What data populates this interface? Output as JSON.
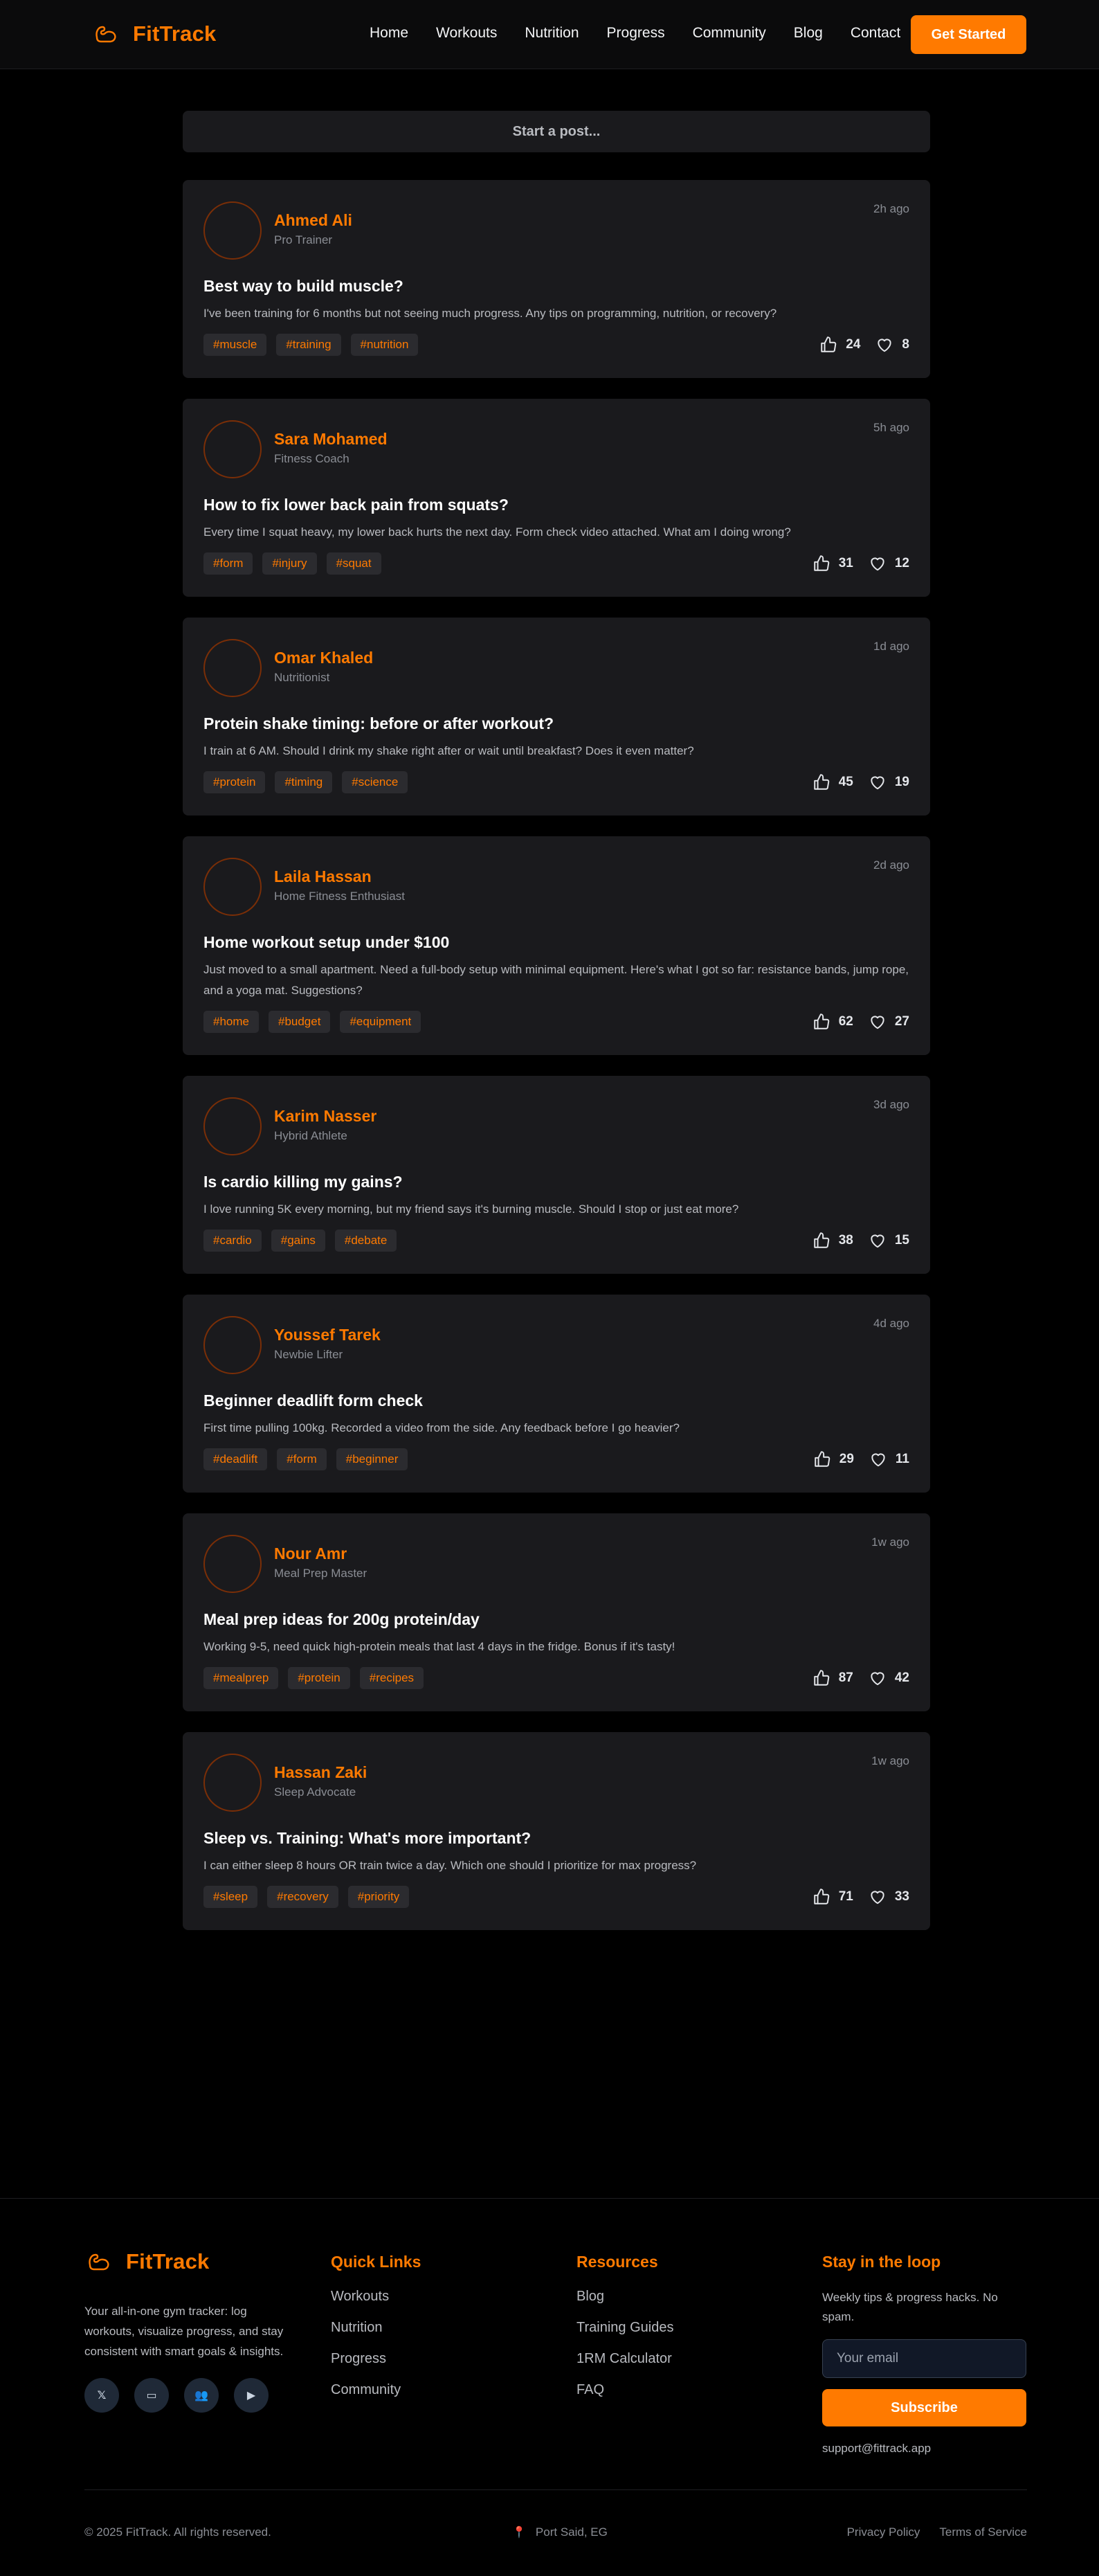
{
  "brand": {
    "name": "FitTrack",
    "accent": "#ff7a00",
    "icon": "flexed-arm-icon"
  },
  "nav": {
    "items": [
      "Home",
      "Workouts",
      "Nutrition",
      "Progress",
      "Community",
      "Blog",
      "Contact"
    ],
    "cta": "Get Started"
  },
  "composer": {
    "label": "Start a post..."
  },
  "posts": [
    {
      "author": "Ahmed Ali",
      "role": "Pro Trainer",
      "time": "2h ago",
      "title": "Best way to build muscle?",
      "body": "I've been training for 6 months but not seeing much progress. Any tips on programming, nutrition, or recovery?",
      "tags": [
        "#muscle",
        "#training",
        "#nutrition"
      ],
      "likes": "24",
      "hearts": "8"
    },
    {
      "author": "Sara Mohamed",
      "role": "Fitness Coach",
      "time": "5h ago",
      "title": "How to fix lower back pain from squats?",
      "body": "Every time I squat heavy, my lower back hurts the next day. Form check video attached. What am I doing wrong?",
      "tags": [
        "#form",
        "#injury",
        "#squat"
      ],
      "likes": "31",
      "hearts": "12"
    },
    {
      "author": "Omar Khaled",
      "role": "Nutritionist",
      "time": "1d ago",
      "title": "Protein shake timing: before or after workout?",
      "body": "I train at 6 AM. Should I drink my shake right after or wait until breakfast? Does it even matter?",
      "tags": [
        "#protein",
        "#timing",
        "#science"
      ],
      "likes": "45",
      "hearts": "19"
    },
    {
      "author": "Laila Hassan",
      "role": "Home Fitness Enthusiast",
      "time": "2d ago",
      "title": "Home workout setup under $100",
      "body": "Just moved to a small apartment. Need a full-body setup with minimal equipment. Here's what I got so far: resistance bands, jump rope, and a yoga mat. Suggestions?",
      "tags": [
        "#home",
        "#budget",
        "#equipment"
      ],
      "likes": "62",
      "hearts": "27"
    },
    {
      "author": "Karim Nasser",
      "role": "Hybrid Athlete",
      "time": "3d ago",
      "title": "Is cardio killing my gains?",
      "body": "I love running 5K every morning, but my friend says it's burning muscle. Should I stop or just eat more?",
      "tags": [
        "#cardio",
        "#gains",
        "#debate"
      ],
      "likes": "38",
      "hearts": "15"
    },
    {
      "author": "Youssef Tarek",
      "role": "Newbie Lifter",
      "time": "4d ago",
      "title": "Beginner deadlift form check",
      "body": "First time pulling 100kg. Recorded a video from the side. Any feedback before I go heavier?",
      "tags": [
        "#deadlift",
        "#form",
        "#beginner"
      ],
      "likes": "29",
      "hearts": "11"
    },
    {
      "author": "Nour Amr",
      "role": "Meal Prep Master",
      "time": "1w ago",
      "title": "Meal prep ideas for 200g protein/day",
      "body": "Working 9-5, need quick high-protein meals that last 4 days in the fridge. Bonus if it's tasty!",
      "tags": [
        "#mealprep",
        "#protein",
        "#recipes"
      ],
      "likes": "87",
      "hearts": "42"
    },
    {
      "author": "Hassan Zaki",
      "role": "Sleep Advocate",
      "time": "1w ago",
      "title": "Sleep vs. Training: What's more important?",
      "body": "I can either sleep 8 hours OR train twice a day. Which one should I prioritize for max progress?",
      "tags": [
        "#sleep",
        "#recovery",
        "#priority"
      ],
      "likes": "71",
      "hearts": "33"
    }
  ],
  "footer": {
    "description": "Your all-in-one gym tracker: log workouts, visualize progress, and stay consistent with smart goals & insights.",
    "socials": [
      {
        "icon": "x-twitter-icon",
        "glyph": "𝕏"
      },
      {
        "icon": "card-icon",
        "glyph": "▭"
      },
      {
        "icon": "group-icon",
        "glyph": "👥"
      },
      {
        "icon": "play-icon",
        "glyph": "▶"
      }
    ],
    "quick_links": {
      "title": "Quick Links",
      "items": [
        "Workouts",
        "Nutrition",
        "Progress",
        "Community"
      ]
    },
    "resources": {
      "title": "Resources",
      "items": [
        "Blog",
        "Training Guides",
        "1RM Calculator",
        "FAQ"
      ]
    },
    "newsletter": {
      "title": "Stay in the loop",
      "description": "Weekly tips & progress hacks. No spam.",
      "placeholder": "Your email",
      "button": "Subscribe",
      "support_email": "support@fittrack.app"
    },
    "copyright": "© 2025 FitTrack. All rights reserved.",
    "location": "Port Said, EG",
    "legal": [
      "Privacy Policy",
      "Terms of Service"
    ]
  }
}
